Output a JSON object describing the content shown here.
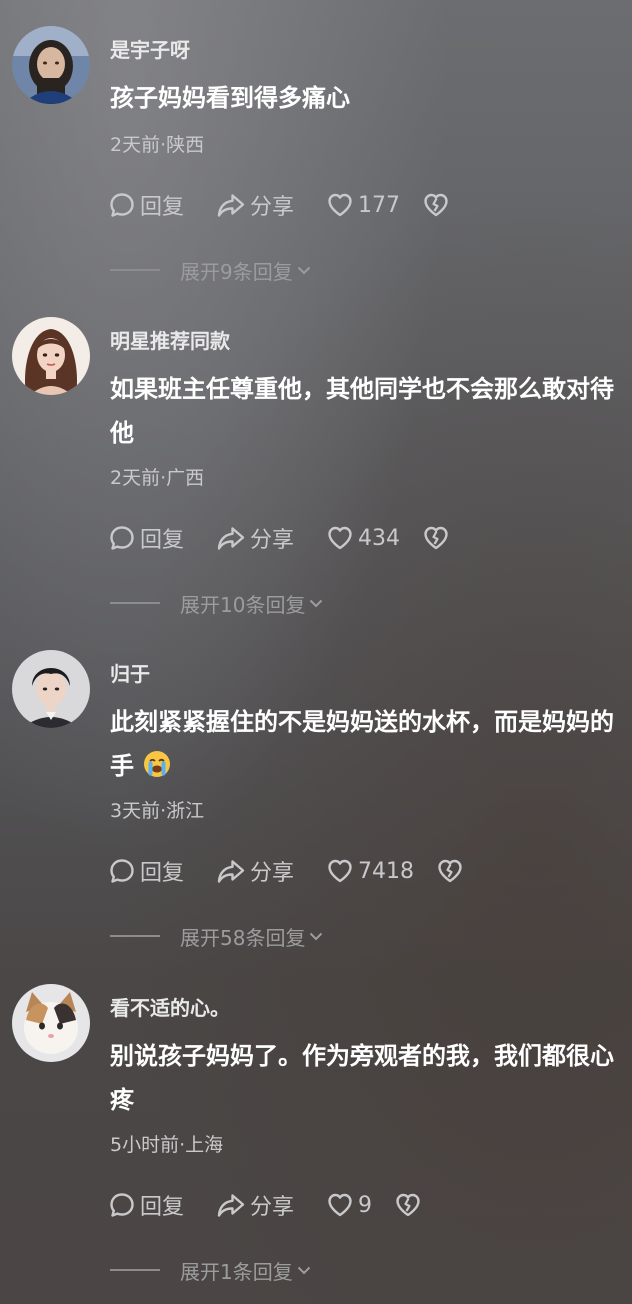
{
  "actions": {
    "reply_label": "回复",
    "share_label": "分享"
  },
  "comments": [
    {
      "username": "是宇子呀",
      "text": "孩子妈妈看到得多痛心",
      "meta": "2天前·陕西",
      "likes": "177",
      "expand": "展开9条回复",
      "avatar": "avatar-girl-dark-hair"
    },
    {
      "username": "明星推荐同款",
      "text": "如果班主任尊重他，其他同学也不会那么敢对待他",
      "meta": "2天前·广西",
      "likes": "434",
      "expand": "展开10条回复",
      "avatar": "avatar-illustrated-woman"
    },
    {
      "username": "归于",
      "text": "此刻紧紧握住的不是妈妈送的水杯，而是妈妈的手",
      "emoji": "loudly-crying-face",
      "meta": "3天前·浙江",
      "likes": "7418",
      "expand": "展开58条回复",
      "avatar": "avatar-young-man"
    },
    {
      "username": "看不适的心。",
      "text": "别说孩子妈妈了。作为旁观者的我，我们都很心疼",
      "meta": "5小时前·上海",
      "likes": "9",
      "expand": "展开1条回复",
      "avatar": "avatar-cat"
    }
  ],
  "colors": {
    "text_primary": "#ffffff",
    "text_secondary": "#c9c9cc",
    "text_muted": "#9c9c9f"
  }
}
